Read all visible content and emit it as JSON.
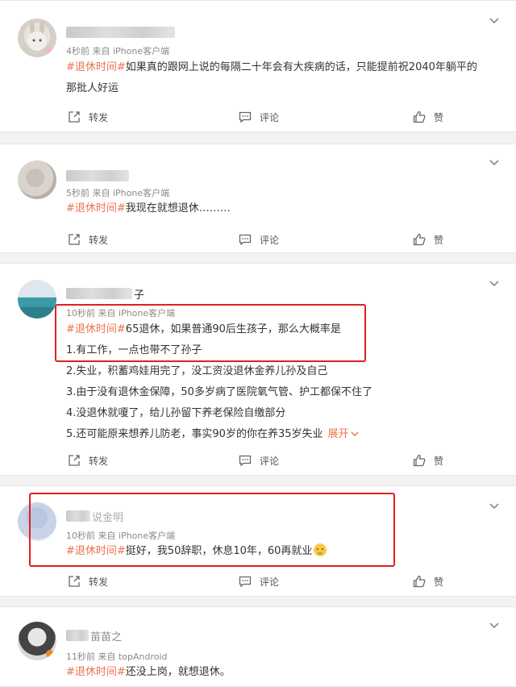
{
  "posts": [
    {
      "meta": "4秒前  来自 iPhone客户端",
      "tag": "#退休时间#",
      "lines": [
        "如果真的跟网上说的每隔二十年会有大疾病的话，只能提前祝2040年躺平的",
        "那批人好运"
      ],
      "actions": {
        "repost": "转发",
        "comment": "评论",
        "like": "赞"
      }
    },
    {
      "meta": "5秒前  来自 iPhone客户端",
      "tag": "#退休时间#",
      "lines": [
        "我现在就想退休………"
      ],
      "actions": {
        "repost": "转发",
        "comment": "评论",
        "like": "赞"
      }
    },
    {
      "name_suffix": "子",
      "meta": "10秒前  来自 iPhone客户端",
      "tag": "#退休时间#",
      "lines": [
        "65退休，如果普通90后生孩子，那么大概率是",
        "1.有工作，一点也带不了孙子",
        "2.失业，积蓄鸡娃用完了，没工资没退休金养儿孙及自己",
        "3.由于没有退休金保障，50多岁病了医院氧气管、护工都保不住了",
        "4.没退休就嗄了，给儿孙留下养老保险自缴部分",
        "5.还可能原来想养儿防老，事实90岁的你在养35岁失业"
      ],
      "expand": "展开",
      "actions": {
        "repost": "转发",
        "comment": "评论",
        "like": "赞"
      }
    },
    {
      "name_suffix": "说金明",
      "meta": "10秒前  来自 iPhone客户端",
      "tag": "#退休时间#",
      "lines": [
        "挺好，我50辞职，休息10年，60再就业"
      ],
      "actions": {
        "repost": "转发",
        "comment": "评论",
        "like": "赞"
      }
    },
    {
      "name_suffix": "苗苗之",
      "meta": "11秒前  来自 topAndroid",
      "tag": "#退休时间#",
      "lines": [
        "还没上岗，就想退休。"
      ]
    }
  ],
  "colors": {
    "tag": "#eb7350",
    "highlight_box": "#e02020",
    "card": "#ffffff",
    "background": "#f2f2f2"
  },
  "icons": [
    "chevron-down-icon",
    "repost-icon",
    "comment-icon",
    "like-icon",
    "smile-emoji-icon"
  ]
}
